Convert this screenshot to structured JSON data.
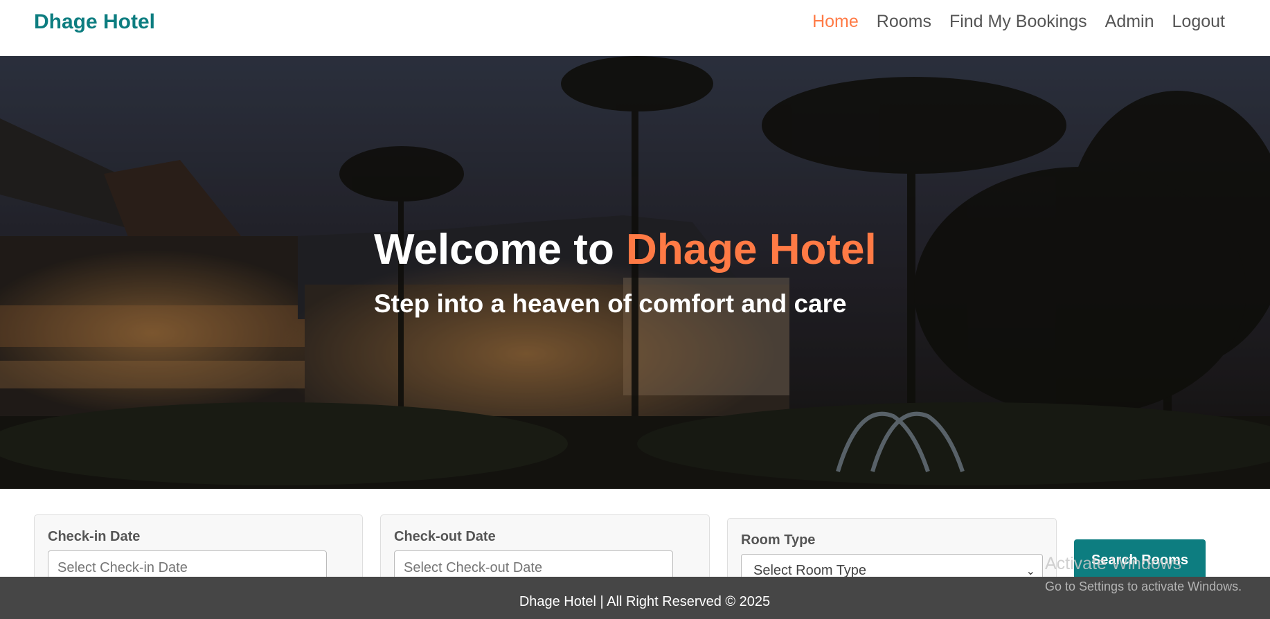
{
  "brand": "Dhage Hotel",
  "nav": {
    "items": [
      {
        "label": "Home",
        "active": true
      },
      {
        "label": "Rooms",
        "active": false
      },
      {
        "label": "Find My Bookings",
        "active": false
      },
      {
        "label": "Admin",
        "active": false
      },
      {
        "label": "Logout",
        "active": false
      }
    ]
  },
  "hero": {
    "title_prefix": "Welcome to ",
    "title_accent": "Dhage Hotel",
    "subtitle": "Step into a heaven of comfort and care"
  },
  "search": {
    "checkin_label": "Check-in Date",
    "checkin_placeholder": "Select Check-in Date",
    "checkout_label": "Check-out Date",
    "checkout_placeholder": "Select Check-out Date",
    "roomtype_label": "Room Type",
    "roomtype_selected": "Select Room Type",
    "button_label": "Search Rooms"
  },
  "footer": {
    "text": "Dhage Hotel | All Right Reserved © 2025"
  },
  "watermark": {
    "title": "Activate Windows",
    "subtitle": "Go to Settings to activate Windows."
  },
  "colors": {
    "brand": "#0d7d80",
    "accent": "#ff7a45",
    "footer": "#464646"
  }
}
